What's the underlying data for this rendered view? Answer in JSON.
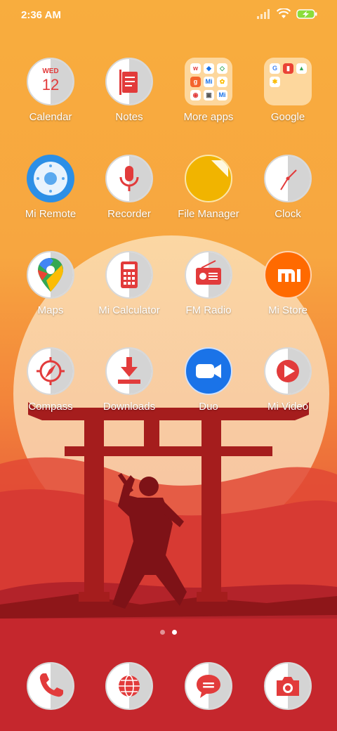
{
  "status": {
    "time": "2:36 AM"
  },
  "home": {
    "apps": [
      {
        "label": "Calendar"
      },
      {
        "label": "Notes"
      },
      {
        "label": "More apps"
      },
      {
        "label": "Google"
      },
      {
        "label": "Mi Remote"
      },
      {
        "label": "Recorder"
      },
      {
        "label": "File Manager"
      },
      {
        "label": "Clock"
      },
      {
        "label": "Maps"
      },
      {
        "label": "Mi Calculator"
      },
      {
        "label": "FM Radio"
      },
      {
        "label": "Mi Store"
      },
      {
        "label": "Compass"
      },
      {
        "label": "Downloads"
      },
      {
        "label": "Duo"
      },
      {
        "label": "Mi Video"
      }
    ],
    "calendar_day": "WED",
    "calendar_date": "12",
    "mi_store_logo": "mi"
  },
  "page_indicator": {
    "pages": 2,
    "current": 2
  },
  "dock": [
    "phone-icon",
    "browser-icon",
    "messages-icon",
    "camera-icon"
  ],
  "colors": {
    "accent_red": "#e23b3b",
    "sky_top": "#f7a93a",
    "sun": "#fbe3c0",
    "torii": "#a51d1d"
  }
}
